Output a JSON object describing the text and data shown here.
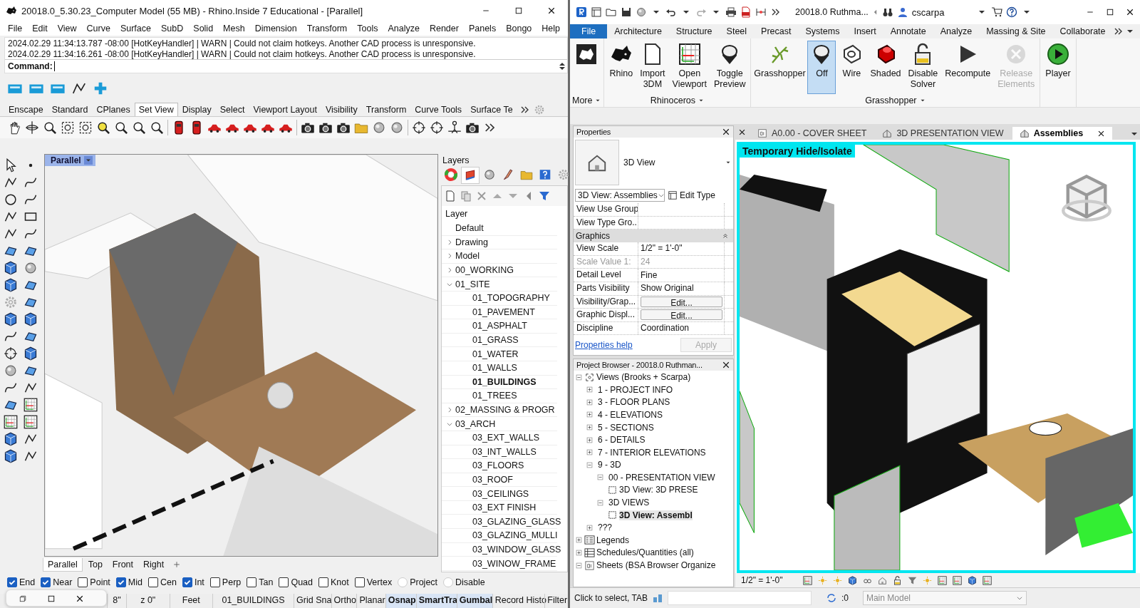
{
  "rhino": {
    "title": "20018.0_5.30.23_Computer Model (55 MB) - Rhino.Inside 7 Educational - [Parallel]",
    "menu": [
      "File",
      "Edit",
      "View",
      "Curve",
      "Surface",
      "SubD",
      "Solid",
      "Mesh",
      "Dimension",
      "Transform",
      "Tools",
      "Analyze",
      "Render",
      "Panels",
      "Bongo",
      "Help"
    ],
    "log": [
      "2024.02.29 11:34:13.787 -08:00 [HotKeyHandler] | WARN | Could not claim hotkeys. Another CAD process is unresponsive.",
      "2024.02.29 11:34:16.261 -08:00 [HotKeyHandler] | WARN | Could not claim hotkeys. Another CAD process is unresponsive."
    ],
    "command": {
      "label": "Command:"
    },
    "toolbar_tabs": [
      {
        "label": "Enscape",
        "selected": false
      },
      {
        "label": "Standard",
        "selected": false
      },
      {
        "label": "CPlanes",
        "selected": false
      },
      {
        "label": "Set View",
        "selected": true
      },
      {
        "label": "Display",
        "selected": false
      },
      {
        "label": "Select",
        "selected": false
      },
      {
        "label": "Viewport Layout",
        "selected": false
      },
      {
        "label": "Visibility",
        "selected": false
      },
      {
        "label": "Transform",
        "selected": false
      },
      {
        "label": "Curve Tools",
        "selected": false
      },
      {
        "label": "Surface Te",
        "selected": false
      }
    ],
    "viewport": {
      "label": "Parallel"
    },
    "viewport_tabs": [
      {
        "label": "Parallel",
        "selected": true
      },
      {
        "label": "Top",
        "selected": false
      },
      {
        "label": "Front",
        "selected": false
      },
      {
        "label": "Right",
        "selected": false
      }
    ],
    "layers": {
      "title": "Layers",
      "header": "Layer",
      "items": [
        {
          "label": "Default",
          "kind": "leaf",
          "current": false
        },
        {
          "label": "Drawing",
          "kind": "group",
          "expanded": false,
          "current": false
        },
        {
          "label": "Model",
          "kind": "group",
          "expanded": false,
          "current": false
        },
        {
          "label": "00_WORKING",
          "kind": "group",
          "expanded": false,
          "current": false
        },
        {
          "label": "01_SITE",
          "kind": "group",
          "expanded": true,
          "current": false,
          "children": [
            {
              "label": "01_TOPOGRAPHY",
              "kind": "leaf",
              "current": false
            },
            {
              "label": "01_PAVEMENT",
              "kind": "leaf",
              "current": false
            },
            {
              "label": "01_ASPHALT",
              "kind": "leaf",
              "current": false
            },
            {
              "label": "01_GRASS",
              "kind": "leaf",
              "current": false
            },
            {
              "label": "01_WATER",
              "kind": "leaf",
              "current": false
            },
            {
              "label": "01_WALLS",
              "kind": "leaf",
              "current": false
            },
            {
              "label": "01_BUILDINGS",
              "kind": "leaf",
              "current": true
            },
            {
              "label": "01_TREES",
              "kind": "leaf",
              "current": false
            }
          ]
        },
        {
          "label": "02_MASSING & PROGR",
          "kind": "group",
          "expanded": false,
          "current": false
        },
        {
          "label": "03_ARCH",
          "kind": "group",
          "expanded": true,
          "current": false,
          "children": [
            {
              "label": "03_EXT_WALLS",
              "kind": "leaf",
              "current": false
            },
            {
              "label": "03_INT_WALLS",
              "kind": "leaf",
              "current": false
            },
            {
              "label": "03_FLOORS",
              "kind": "leaf",
              "current": false
            },
            {
              "label": "03_ROOF",
              "kind": "leaf",
              "current": false
            },
            {
              "label": "03_CEILINGS",
              "kind": "leaf",
              "current": false
            },
            {
              "label": "03_EXT FINISH",
              "kind": "leaf",
              "current": false
            },
            {
              "label": "03_GLAZING_GLASS",
              "kind": "leaf",
              "current": false
            },
            {
              "label": "03_GLAZING_MULLI",
              "kind": "leaf",
              "current": false
            },
            {
              "label": "03_WINDOW_GLASS",
              "kind": "leaf",
              "current": false
            },
            {
              "label": "03_WINOW_FRAME",
              "kind": "leaf",
              "current": false
            }
          ]
        }
      ]
    },
    "osnaps": [
      {
        "label": "End",
        "kind": "checkbox",
        "checked": true
      },
      {
        "label": "Near",
        "kind": "checkbox",
        "checked": true
      },
      {
        "label": "Point",
        "kind": "checkbox",
        "checked": false
      },
      {
        "label": "Mid",
        "kind": "checkbox",
        "checked": true
      },
      {
        "label": "Cen",
        "kind": "checkbox",
        "checked": false
      },
      {
        "label": "Int",
        "kind": "checkbox",
        "checked": true
      },
      {
        "label": "Perp",
        "kind": "checkbox",
        "checked": false
      },
      {
        "label": "Tan",
        "kind": "checkbox",
        "checked": false
      },
      {
        "label": "Quad",
        "kind": "checkbox",
        "checked": false
      },
      {
        "label": "Knot",
        "kind": "checkbox",
        "checked": false
      },
      {
        "label": "Vertex",
        "kind": "checkbox",
        "checked": false
      },
      {
        "label": "Project",
        "kind": "radio",
        "checked": false
      },
      {
        "label": "Disable",
        "kind": "radio",
        "checked": false
      }
    ],
    "status": [
      {
        "text": "8\"",
        "on": false
      },
      {
        "text": "z 0\"",
        "on": false
      },
      {
        "text": "Feet",
        "on": false
      },
      {
        "text": "01_BUILDINGS",
        "on": false
      },
      {
        "text": "Grid Sna",
        "on": false
      },
      {
        "text": "Ortho",
        "on": false
      },
      {
        "text": "Planar",
        "on": false
      },
      {
        "text": "Osnap",
        "on": true
      },
      {
        "text": "SmartTra",
        "on": true
      },
      {
        "text": "Gumbal",
        "on": true
      },
      {
        "text": "Record Histo",
        "on": false
      },
      {
        "text": "Filter",
        "on": false
      }
    ]
  },
  "revit": {
    "title": "20018.0 Ruthma...",
    "user": "cscarpa",
    "tabs": [
      {
        "label": "File",
        "kind": "file"
      },
      {
        "label": "Architecture",
        "kind": "tab"
      },
      {
        "label": "Structure",
        "kind": "tab"
      },
      {
        "label": "Steel",
        "kind": "tab"
      },
      {
        "label": "Precast",
        "kind": "tab"
      },
      {
        "label": "Systems",
        "kind": "tab"
      },
      {
        "label": "Insert",
        "kind": "tab"
      },
      {
        "label": "Annotate",
        "kind": "tab"
      },
      {
        "label": "Analyze",
        "kind": "tab"
      },
      {
        "label": "Massing & Site",
        "kind": "tab"
      },
      {
        "label": "Collaborate",
        "kind": "tab"
      }
    ],
    "panels": [
      {
        "label": "More",
        "buttons": [
          {
            "selected": false,
            "disabled": false
          }
        ]
      },
      {
        "label": "Rhinoceros",
        "buttons": [
          {
            "label": "Rhino",
            "selected": false,
            "disabled": false
          },
          {
            "label": "Import 3DM",
            "selected": false,
            "disabled": false
          },
          {
            "label": "Open Viewport",
            "selected": false,
            "disabled": false
          },
          {
            "label": "Toggle Preview",
            "selected": false,
            "disabled": false
          }
        ]
      },
      {
        "label": "Grasshopper",
        "buttons": [
          {
            "label": "Grasshopper",
            "selected": false,
            "disabled": false
          },
          {
            "label": "Off",
            "selected": true,
            "disabled": false
          },
          {
            "label": "Wire",
            "selected": false,
            "disabled": false
          },
          {
            "label": "Shaded",
            "selected": false,
            "disabled": false
          },
          {
            "label": "Disable Solver",
            "selected": false,
            "disabled": false
          },
          {
            "label": "Recompute",
            "selected": false,
            "disabled": false
          },
          {
            "label": "Release Elements",
            "selected": false,
            "disabled": true
          }
        ]
      },
      {
        "buttons": [
          {
            "label": "Player",
            "selected": false,
            "disabled": false
          }
        ]
      }
    ],
    "properties": {
      "title": "Properties",
      "type": "3D View",
      "instance": "3D View: Assemblies",
      "edit_type": "Edit Type",
      "rows": [
        {
          "kind": "value",
          "label": "View Use Group",
          "value": "",
          "disabled": false
        },
        {
          "kind": "value",
          "label": "View Type Gro...",
          "value": "",
          "disabled": false
        },
        {
          "kind": "section",
          "label": "Graphics"
        },
        {
          "kind": "value",
          "label": "View Scale",
          "value": "1/2\" = 1'-0\"",
          "disabled": false
        },
        {
          "kind": "value",
          "label": "Scale Value    1:",
          "value": "24",
          "disabled": true
        },
        {
          "kind": "value",
          "label": "Detail Level",
          "value": "Fine",
          "disabled": false
        },
        {
          "kind": "value",
          "label": "Parts Visibility",
          "value": "Show Original",
          "disabled": false
        },
        {
          "kind": "button",
          "label": "Visibility/Grap...",
          "value": "Edit...",
          "disabled": false
        },
        {
          "kind": "button",
          "label": "Graphic Displ...",
          "value": "Edit...",
          "disabled": false
        },
        {
          "kind": "value",
          "label": "Discipline",
          "value": "Coordination",
          "disabled": false
        }
      ],
      "help": "Properties help",
      "apply": {
        "label": "Apply",
        "disabled": true
      }
    },
    "browser": {
      "title": "Project Browser - 20018.0 Ruthman...",
      "items": [
        {
          "label": "Views (Brooks + Scarpa)",
          "kind": "views",
          "expanded": true,
          "selected": false,
          "children": [
            {
              "label": "1 - PROJECT INFO",
              "kind": "folder",
              "expanded": false,
              "selected": false
            },
            {
              "label": "3 - FLOOR PLANS",
              "kind": "folder",
              "expanded": false,
              "selected": false
            },
            {
              "label": "4 - ELEVATIONS",
              "kind": "folder",
              "expanded": false,
              "selected": false
            },
            {
              "label": "5 - SECTIONS",
              "kind": "folder",
              "expanded": false,
              "selected": false
            },
            {
              "label": "6 - DETAILS",
              "kind": "folder",
              "expanded": false,
              "selected": false
            },
            {
              "label": "7 - INTERIOR ELEVATIONS",
              "kind": "folder",
              "expanded": false,
              "selected": false
            },
            {
              "label": "9 - 3D",
              "kind": "folder",
              "expanded": true,
              "selected": false,
              "children": [
                {
                  "label": "00 - PRESENTATION VIEW",
                  "kind": "folder",
                  "expanded": true,
                  "selected": false,
                  "children": [
                    {
                      "label": "3D View: 3D PRESE",
                      "kind": "view",
                      "selected": false
                    }
                  ]
                },
                {
                  "label": "3D VIEWS",
                  "kind": "folder",
                  "expanded": true,
                  "selected": false,
                  "children": [
                    {
                      "label": "3D View: Assembl",
                      "kind": "view",
                      "selected": true
                    }
                  ]
                }
              ]
            },
            {
              "label": "???",
              "kind": "folder",
              "expanded": false,
              "selected": false
            }
          ]
        },
        {
          "label": "Legends",
          "kind": "legends",
          "expanded": false,
          "selected": false
        },
        {
          "label": "Schedules/Quantities (all)",
          "kind": "schedules",
          "expanded": false,
          "selected": false
        },
        {
          "label": "Sheets (BSA Browser Organize",
          "kind": "sheets",
          "expanded": true,
          "selected": false
        }
      ]
    },
    "doc_tabs": [
      {
        "label": "A0.00 - COVER SHEET",
        "kind": "sheet",
        "selected": false
      },
      {
        "label": "3D PRESENTATION VIEW",
        "kind": "view3d",
        "selected": false
      },
      {
        "label": "Assemblies",
        "kind": "view3d",
        "selected": true
      }
    ],
    "view": {
      "badge": "Temporary Hide/Isolate",
      "scale": "1/2\" = 1'-0\""
    },
    "status": {
      "hint": "Click to select, TAB",
      "count": ":0",
      "model": "Main Model"
    }
  }
}
